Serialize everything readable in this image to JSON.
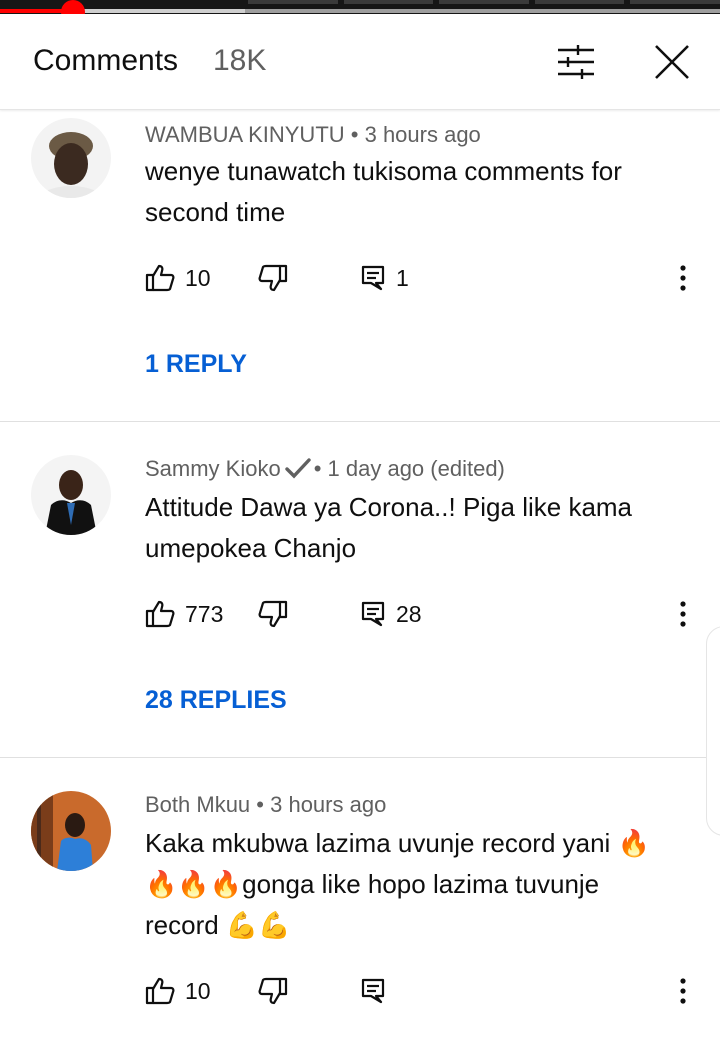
{
  "header": {
    "title": "Comments",
    "count": "18K"
  },
  "video": {
    "played_fraction": 0.1,
    "buffered_fraction": 0.34
  },
  "comments": [
    {
      "author": "WAMBUA KINYUTU",
      "verified": false,
      "meta_suffix": "• 3 hours ago",
      "text_lines": [
        "wenye tunawatch tukisoma comments for",
        "second time"
      ],
      "likes": "10",
      "reply_count": "1",
      "replies_label": "1 REPLY"
    },
    {
      "author": "Sammy Kioko",
      "verified": true,
      "meta_suffix": "• 1 day ago (edited)",
      "text_lines": [
        "Attitude Dawa ya Corona..! Piga like kama",
        "umepokea Chanjo"
      ],
      "likes": "773",
      "reply_count": "28",
      "replies_label": "28 REPLIES"
    },
    {
      "author": "Both Mkuu",
      "verified": false,
      "meta_suffix": "• 3 hours ago",
      "text_lines": [
        "Kaka mkubwa lazima uvunje record yani 🔥",
        "🔥🔥🔥gonga like hopo lazima tuvunje",
        "record 💪💪"
      ],
      "likes": "10",
      "reply_count": "",
      "replies_label": ""
    }
  ],
  "colors": {
    "link": "#065fd4",
    "progress": "#ff0000",
    "secondary_text": "#606060"
  },
  "icons": {
    "filter": "sliders-icon",
    "close": "close-icon",
    "like": "thumbs-up-icon",
    "dislike": "thumbs-down-icon",
    "reply": "comment-icon",
    "more": "more-vert-icon",
    "verified": "checkmark-icon"
  }
}
